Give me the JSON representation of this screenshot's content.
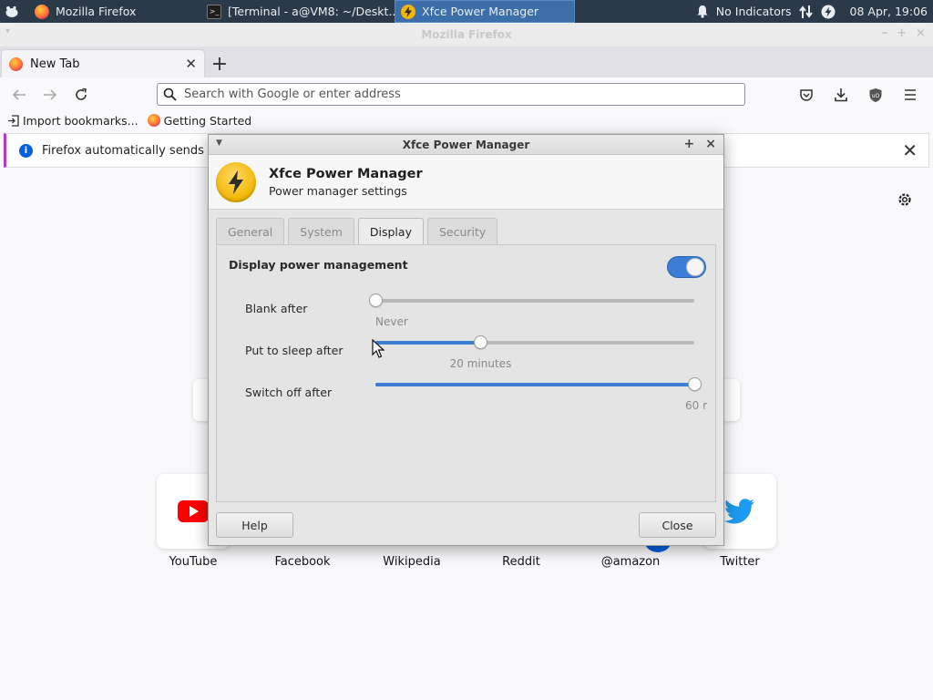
{
  "panel": {
    "tasks": [
      {
        "label": "Mozilla Firefox"
      },
      {
        "label": "[Terminal - a@VM8: ~/Deskt..."
      },
      {
        "label": "Xfce Power Manager"
      }
    ],
    "indicators": "No Indicators",
    "clock": "08 Apr, 19:06"
  },
  "firefox": {
    "window_title": "Mozilla Firefox",
    "tab_label": "New Tab",
    "url_placeholder": "Search with Google or enter address",
    "bookmarks": [
      {
        "label": "Import bookmarks..."
      },
      {
        "label": "Getting Started"
      }
    ],
    "notice_text": "Firefox automatically sends some",
    "top_sites": [
      {
        "label": "YouTube"
      },
      {
        "label": "Facebook"
      },
      {
        "label": "Wikipedia"
      },
      {
        "label": "Reddit"
      },
      {
        "label": "@amazon"
      },
      {
        "label": "Twitter"
      }
    ]
  },
  "dialog": {
    "window_title": "Xfce Power Manager",
    "header_title": "Xfce Power Manager",
    "header_subtitle": "Power manager settings",
    "tabs": [
      {
        "label": "General"
      },
      {
        "label": "System"
      },
      {
        "label": "Display"
      },
      {
        "label": "Security"
      }
    ],
    "active_tab": "Display",
    "display_power_management": {
      "label": "Display power management",
      "enabled": true
    },
    "sliders": [
      {
        "label": "Blank after",
        "value_text": "Never",
        "fraction": 0.0
      },
      {
        "label": "Put to sleep after",
        "value_text": "20 minutes",
        "fraction": 0.33
      },
      {
        "label": "Switch off after",
        "value_text": "60 r",
        "fraction": 1.0
      }
    ],
    "help_label": "Help",
    "close_label": "Close"
  },
  "colors": {
    "panel_bg": "#2b3a48",
    "accent": "#3d7dd6",
    "bolt": "#f2b600"
  }
}
